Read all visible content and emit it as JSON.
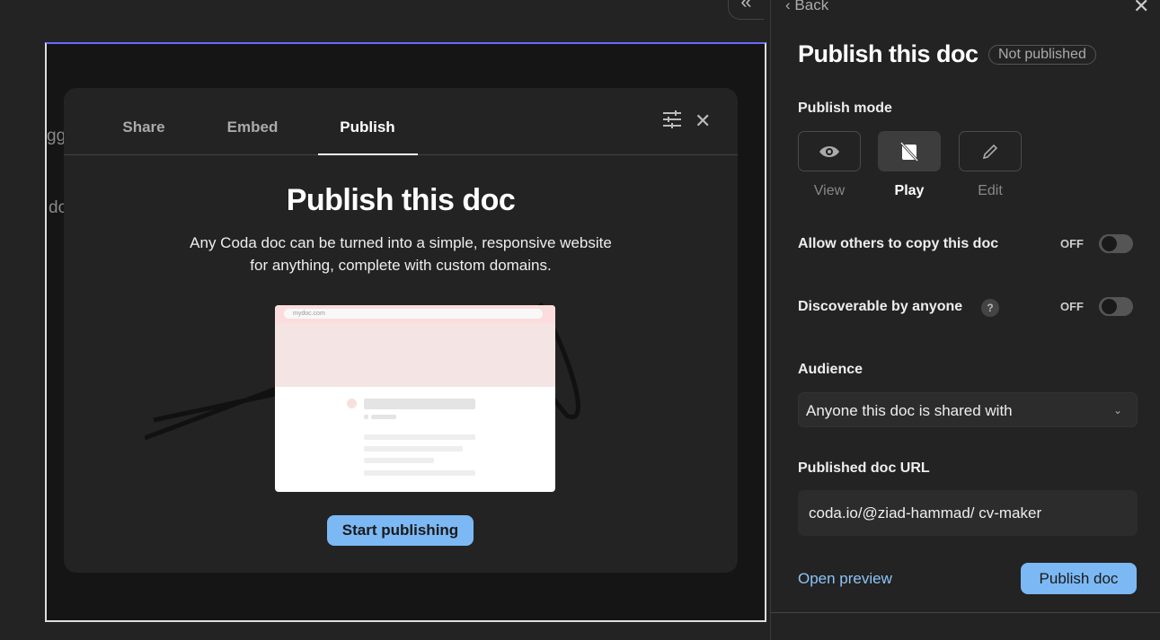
{
  "background": {
    "fragments": [
      "gg",
      "do"
    ]
  },
  "modal": {
    "tabs": [
      {
        "label": "Share"
      },
      {
        "label": "Embed"
      },
      {
        "label": "Publish",
        "active": true
      }
    ],
    "title": "Publish this doc",
    "description": "Any Coda doc can be turned into a simple, responsive website for anything, complete with custom domains.",
    "preview_url": "mydoc.com",
    "start_button": "Start publishing"
  },
  "panel": {
    "back": "Back",
    "title": "Publish this doc",
    "status_badge": "Not published",
    "publish_mode_label": "Publish mode",
    "modes": [
      {
        "label": "View",
        "icon": "eye-icon"
      },
      {
        "label": "Play",
        "icon": "play-mode-icon",
        "selected": true
      },
      {
        "label": "Edit",
        "icon": "pencil-icon"
      }
    ],
    "allow_copy": {
      "label": "Allow others to copy this doc",
      "state": "OFF"
    },
    "discoverable": {
      "label": "Discoverable by anyone",
      "help": "?",
      "state": "OFF"
    },
    "audience_label": "Audience",
    "audience_value": "Anyone this doc is shared with",
    "url_label": "Published doc URL",
    "url_value": "coda.io/@ziad-hammad/ cv-maker",
    "open_preview": "Open preview",
    "publish_button": "Publish doc"
  },
  "colors": {
    "accent": "#7cb8f4",
    "link": "#8cc4f8"
  }
}
